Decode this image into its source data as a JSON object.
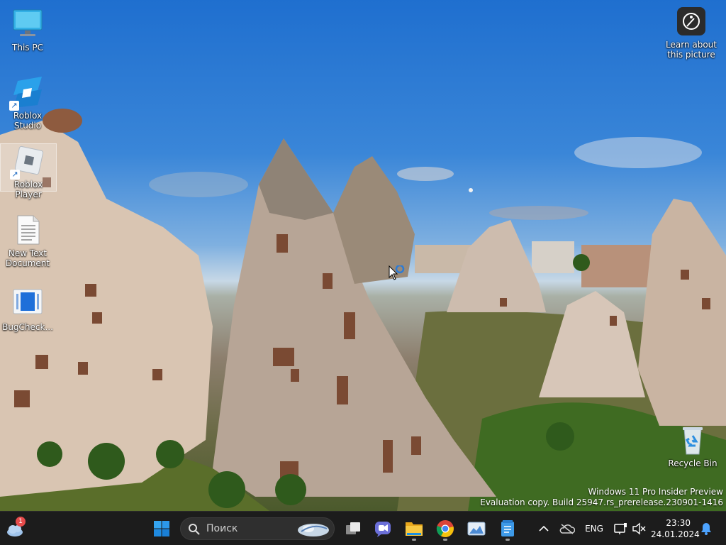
{
  "desktop": {
    "icons": [
      {
        "label": "This PC"
      },
      {
        "label": "Roblox Studio"
      },
      {
        "label": "Roblox Player"
      },
      {
        "label": "New Text Document"
      },
      {
        "label": "BugCheck..."
      },
      {
        "label": "Recycle Bin"
      }
    ],
    "learn_about_picture": "Learn about this picture",
    "watermark": {
      "line1": "Windows 11 Pro Insider Preview",
      "line2": "Evaluation copy. Build 25947.rs_prerelease.230901-1416"
    }
  },
  "taskbar": {
    "widgets_badge": "1",
    "search_placeholder": "Поиск",
    "apps": [
      "start",
      "search",
      "task-view",
      "teams-chat",
      "file-explorer",
      "chrome",
      "photos",
      "notepad"
    ],
    "tray": {
      "language": "ENG",
      "time": "23:30",
      "date": "24.01.2024"
    }
  },
  "colors": {
    "taskbar_bg": "#1c1c1c",
    "accent": "#0078d4",
    "badge": "#e64b4b"
  }
}
